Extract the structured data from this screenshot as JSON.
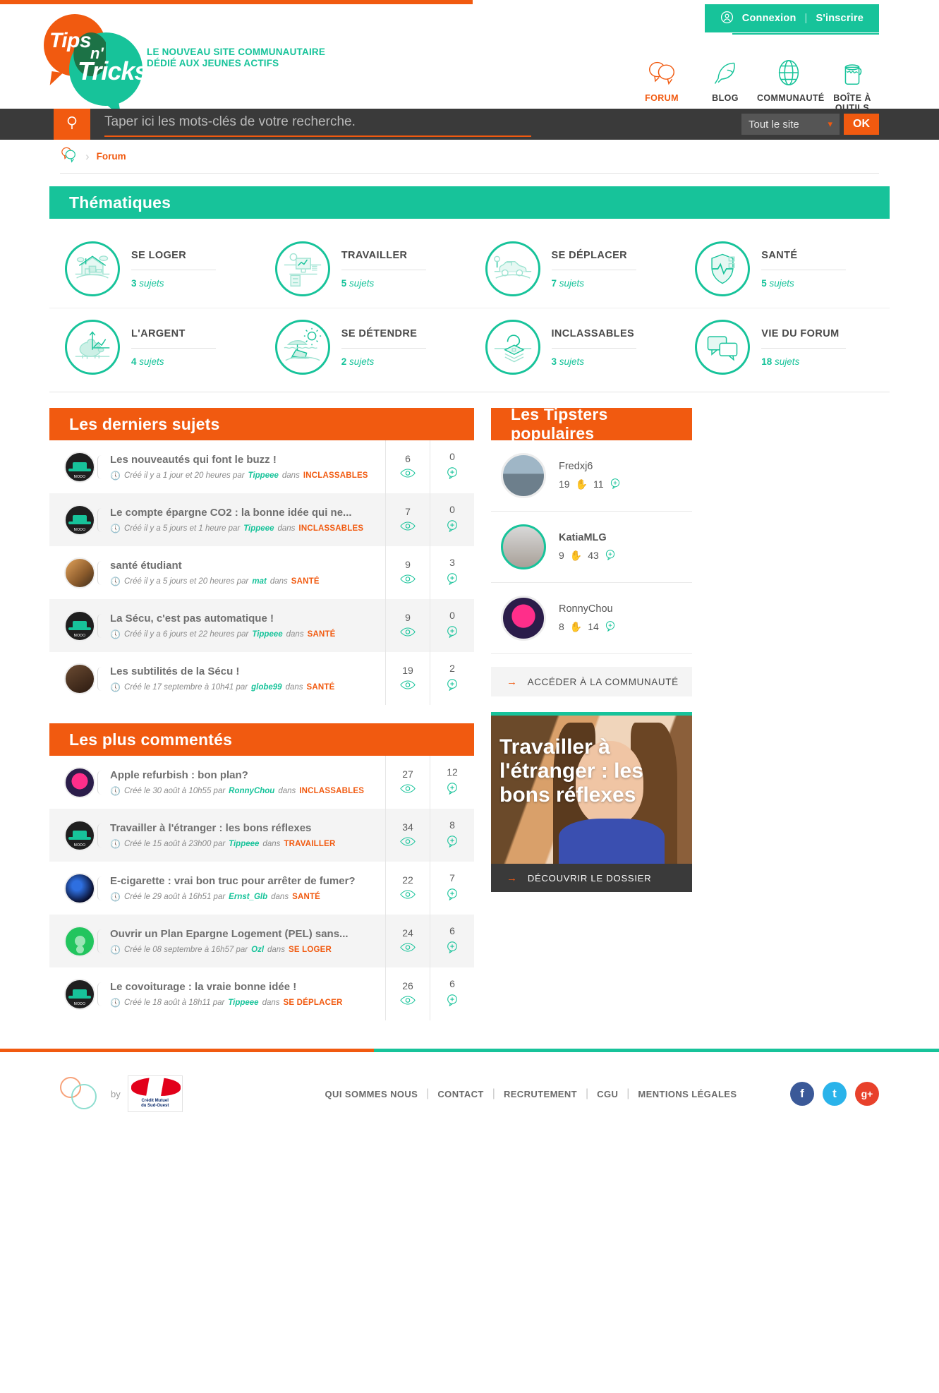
{
  "colors": {
    "teal": "#17c39a",
    "orange": "#f15a10",
    "dark": "#3a3a3a"
  },
  "header": {
    "login": "Connexion",
    "separator": "|",
    "signup": "S'inscrire",
    "logo": {
      "tips": "Tips",
      "n": "n'",
      "tricks": "Tricks"
    },
    "tagline_line1": "LE NOUVEAU SITE COMMUNAUTAIRE",
    "tagline_line2": "DÉDIÉ AUX JEUNES ACTIFS",
    "nav": [
      {
        "label": "FORUM",
        "icon": "speech-bubbles-icon",
        "active": true
      },
      {
        "label": "BLOG",
        "icon": "feather-icon",
        "active": false
      },
      {
        "label": "COMMUNAUTÉ",
        "icon": "globe-icon",
        "active": false
      },
      {
        "label": "BOÎTE À OUTILS",
        "icon": "paint-bucket-icon",
        "active": false
      }
    ]
  },
  "search": {
    "placeholder": "Taper ici les mots-clés de votre recherche.",
    "value": "",
    "scope": "Tout le site",
    "submit": "OK"
  },
  "breadcrumb": {
    "home_icon": "speech-bubbles-icon",
    "current": "Forum"
  },
  "themes": {
    "title": "Thématiques",
    "items": [
      {
        "name": "SE LOGER",
        "count": "3",
        "unit": "sujets",
        "icon": "house-icon"
      },
      {
        "name": "TRAVAILLER",
        "count": "5",
        "unit": "sujets",
        "icon": "desk-icon"
      },
      {
        "name": "SE DÉPLACER",
        "count": "7",
        "unit": "sujets",
        "icon": "car-icon"
      },
      {
        "name": "SANTÉ",
        "count": "5",
        "unit": "sujets",
        "icon": "shield-heart-icon"
      },
      {
        "name": "L'ARGENT",
        "count": "4",
        "unit": "sujets",
        "icon": "piggy-bank-icon"
      },
      {
        "name": "SE DÉTENDRE",
        "count": "2",
        "unit": "sujets",
        "icon": "beach-icon"
      },
      {
        "name": "INCLASSABLES",
        "count": "3",
        "unit": "sujets",
        "icon": "question-papers-icon"
      },
      {
        "name": "VIE DU FORUM",
        "count": "18",
        "unit": "sujets",
        "icon": "chat-bubbles-icon"
      }
    ]
  },
  "latest": {
    "title": "Les derniers sujets",
    "rows": [
      {
        "avatar": "ava-modo",
        "title": "Les nouveautés qui font le buzz !",
        "meta_prefix": "Créé il y a 1 jour et 20 heures par",
        "author": "Tippeee",
        "meta_mid": "dans",
        "category": "INCLASSABLES",
        "views": "6",
        "comments": "0"
      },
      {
        "avatar": "ava-modo",
        "title": "Le compte épargne CO2 : la bonne idée qui ne...",
        "meta_prefix": "Créé il y a 5 jours et 1 heure par",
        "author": "Tippeee",
        "meta_mid": "dans",
        "category": "INCLASSABLES",
        "views": "7",
        "comments": "0"
      },
      {
        "avatar": "ava-food",
        "title": "santé étudiant",
        "meta_prefix": "Créé il y a 5 jours et 20 heures par",
        "author": "mat",
        "meta_mid": "dans",
        "category": "SANTÉ",
        "views": "9",
        "comments": "3"
      },
      {
        "avatar": "ava-modo",
        "title": "La Sécu, c'est pas automatique !",
        "meta_prefix": "Créé il y a 6 jours et 22 heures par",
        "author": "Tippeee",
        "meta_mid": "dans",
        "category": "SANTÉ",
        "views": "9",
        "comments": "0"
      },
      {
        "avatar": "ava-coffee",
        "title": "Les subtilités de la Sécu !",
        "meta_prefix": "Créé le 17 septembre à 10h41 par",
        "author": "globe99",
        "meta_mid": "dans",
        "category": "SANTÉ",
        "views": "19",
        "comments": "2"
      }
    ]
  },
  "commented": {
    "title": "Les plus commentés",
    "rows": [
      {
        "avatar": "ava-roll",
        "title": "Apple refurbish : bon plan?",
        "meta_prefix": "Créé le 30 août à 10h55 par",
        "author": "RonnyChou",
        "meta_mid": "dans",
        "category": "INCLASSABLES",
        "views": "27",
        "comments": "12"
      },
      {
        "avatar": "ava-modo",
        "title": "Travailler à l'étranger : les bons réflexes",
        "meta_prefix": "Créé le 15 août à 23h00 par",
        "author": "Tippeee",
        "meta_mid": "dans",
        "category": "TRAVAILLER",
        "views": "34",
        "comments": "8"
      },
      {
        "avatar": "ava-space",
        "title": "E-cigarette : vrai bon truc pour arrêter de fumer?",
        "meta_prefix": "Créé le 29 août à 16h51 par",
        "author": "Ernst_Glb",
        "meta_mid": "dans",
        "category": "SANTÉ",
        "views": "22",
        "comments": "7"
      },
      {
        "avatar": "ava-green",
        "title": "Ouvrir un Plan Epargne Logement (PEL) sans...",
        "meta_prefix": "Créé le 08 septembre à 16h57 par",
        "author": "Ozl",
        "meta_mid": "dans",
        "category": "SE LOGER",
        "views": "24",
        "comments": "6"
      },
      {
        "avatar": "ava-modo",
        "title": "Le covoiturage : la vraie bonne idée !",
        "meta_prefix": "Créé le 18 août à 18h11 par",
        "author": "Tippeee",
        "meta_mid": "dans",
        "category": "SE DÉPLACER",
        "views": "26",
        "comments": "6"
      }
    ]
  },
  "tipsters": {
    "title": "Les Tipsters populaires",
    "items": [
      {
        "name": "Fredxj6",
        "avatar": "ava-lake",
        "highlight": false,
        "bold": false,
        "hands": "19",
        "comments": "11"
      },
      {
        "name": "KatiaMLG",
        "avatar": "ava-katia",
        "highlight": true,
        "bold": true,
        "hands": "9",
        "comments": "43"
      },
      {
        "name": "RonnyChou",
        "avatar": "ava-roll",
        "highlight": false,
        "bold": false,
        "hands": "8",
        "comments": "14"
      }
    ],
    "cta": "ACCÉDER À LA COMMUNAUTÉ"
  },
  "promo": {
    "title": "Travailler à l'étranger : les bons réflexes",
    "cta": "DÉCOUVRIR LE DOSSIER"
  },
  "footer": {
    "by": "by",
    "partner_line1": "Crédit",
    "partner_line2": "Mutuel",
    "partner_line3": "du Sud-Ouest",
    "links": [
      "QUI SOMMES NOUS",
      "CONTACT",
      "RECRUTEMENT",
      "CGU",
      "MENTIONS LÉGALES"
    ],
    "divider": "|",
    "socials": [
      {
        "name": "facebook-icon",
        "glyph": "f"
      },
      {
        "name": "twitter-icon",
        "glyph": "t"
      },
      {
        "name": "google-plus-icon",
        "glyph": "g+"
      }
    ]
  }
}
